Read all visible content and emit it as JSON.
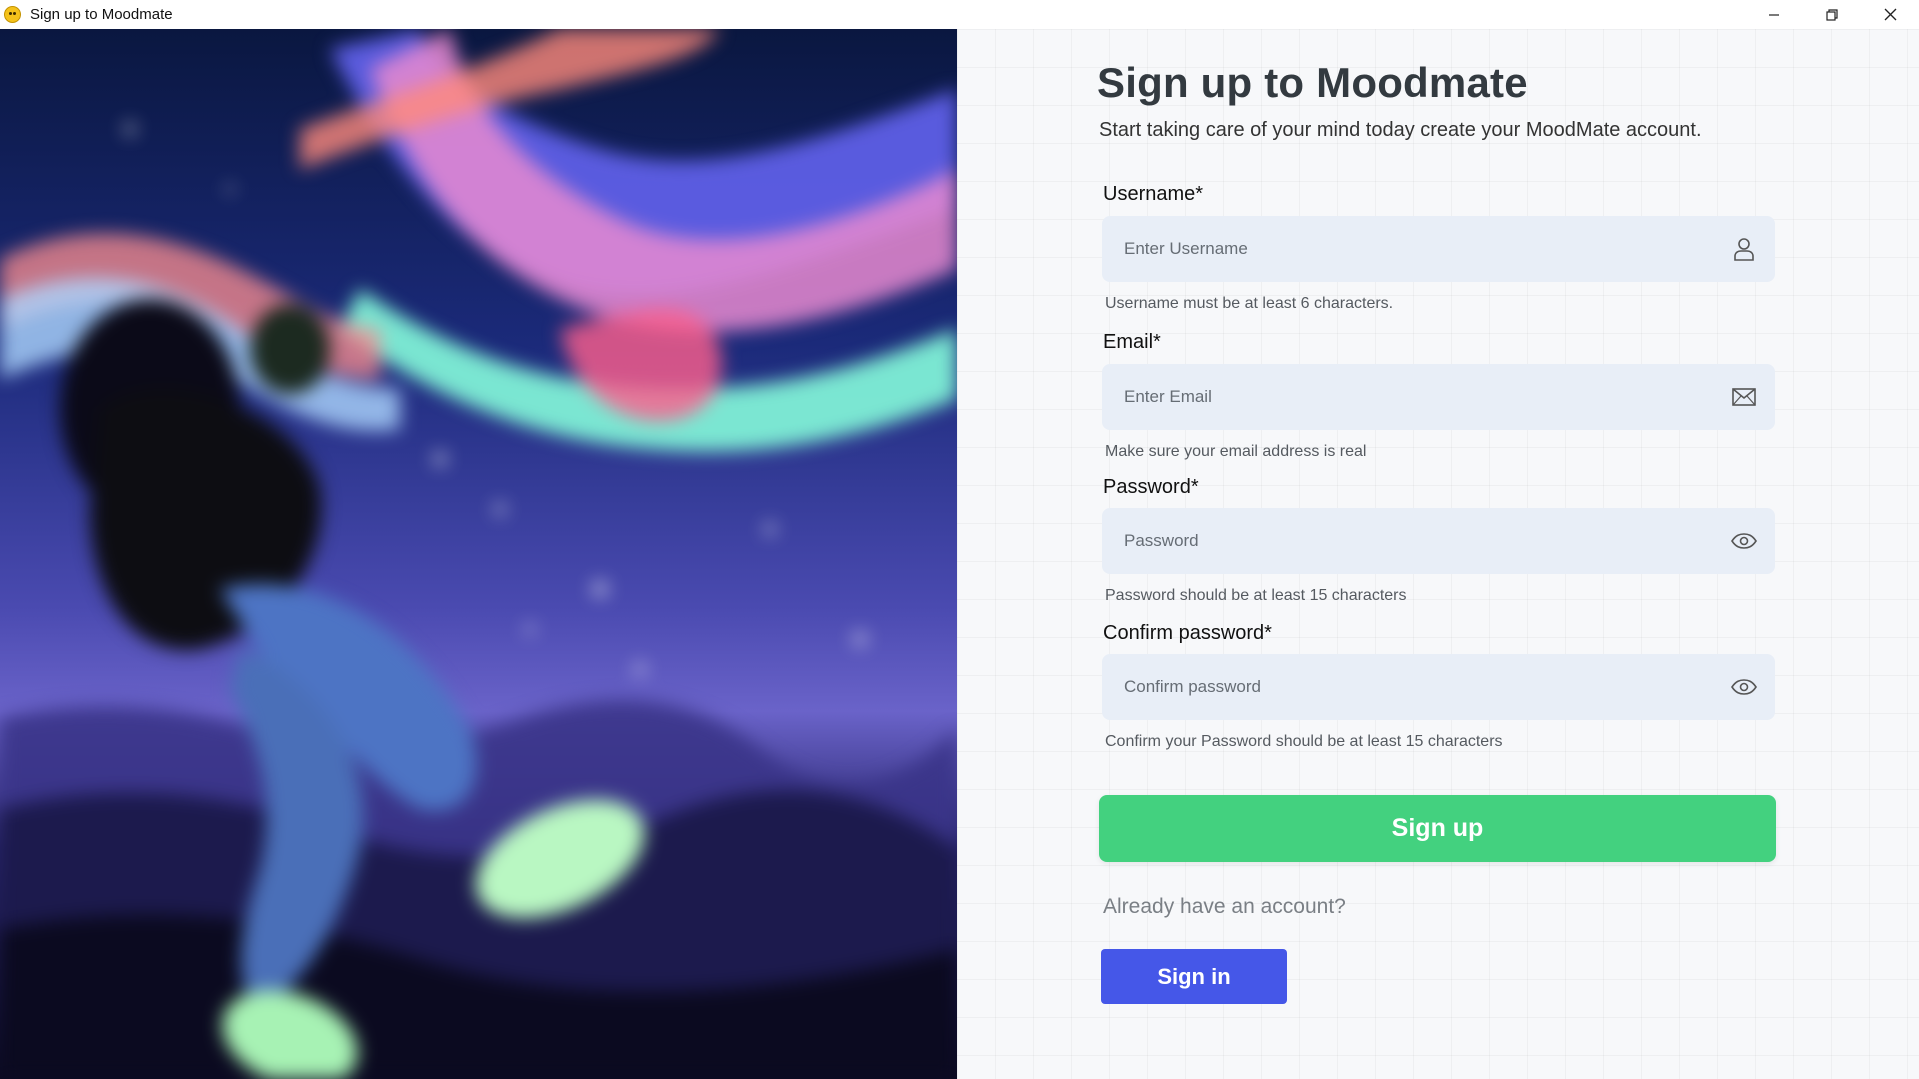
{
  "window": {
    "title": "Sign up to Moodmate",
    "app_icon": "smiley-face-icon",
    "controls": [
      "minimize-icon",
      "restore-icon",
      "close-icon"
    ]
  },
  "hero": {
    "image_icon": "illustration-floating-person-aurora"
  },
  "form": {
    "heading": "Sign up to Moodmate",
    "subtitle": "Start taking care of your mind today create your MoodMate account.",
    "fields": [
      {
        "label": "Username*",
        "placeholder": "Enter Username",
        "value": "",
        "icon": "user-icon",
        "hint": "Username must be at least 6 characters."
      },
      {
        "label": "Email*",
        "placeholder": "Enter Email",
        "value": "",
        "icon": "envelope-icon",
        "hint": "Make sure your email address is real"
      },
      {
        "label": "Password*",
        "placeholder": "Password",
        "value": "",
        "icon": "eye-icon",
        "hint": "Password should be at least 15 characters"
      },
      {
        "label": "Confirm password*",
        "placeholder": "Confirm password",
        "value": "",
        "icon": "eye-icon",
        "hint": "Confirm your Password should be at least 15 characters"
      }
    ],
    "signup_label": "Sign up",
    "already_text": "Already have an account?",
    "signin_label": "Sign in"
  },
  "colors": {
    "signup_button": "#43d17f",
    "signin_button": "#4557e8",
    "field_background": "#e8eef7",
    "heading": "#333a40"
  }
}
